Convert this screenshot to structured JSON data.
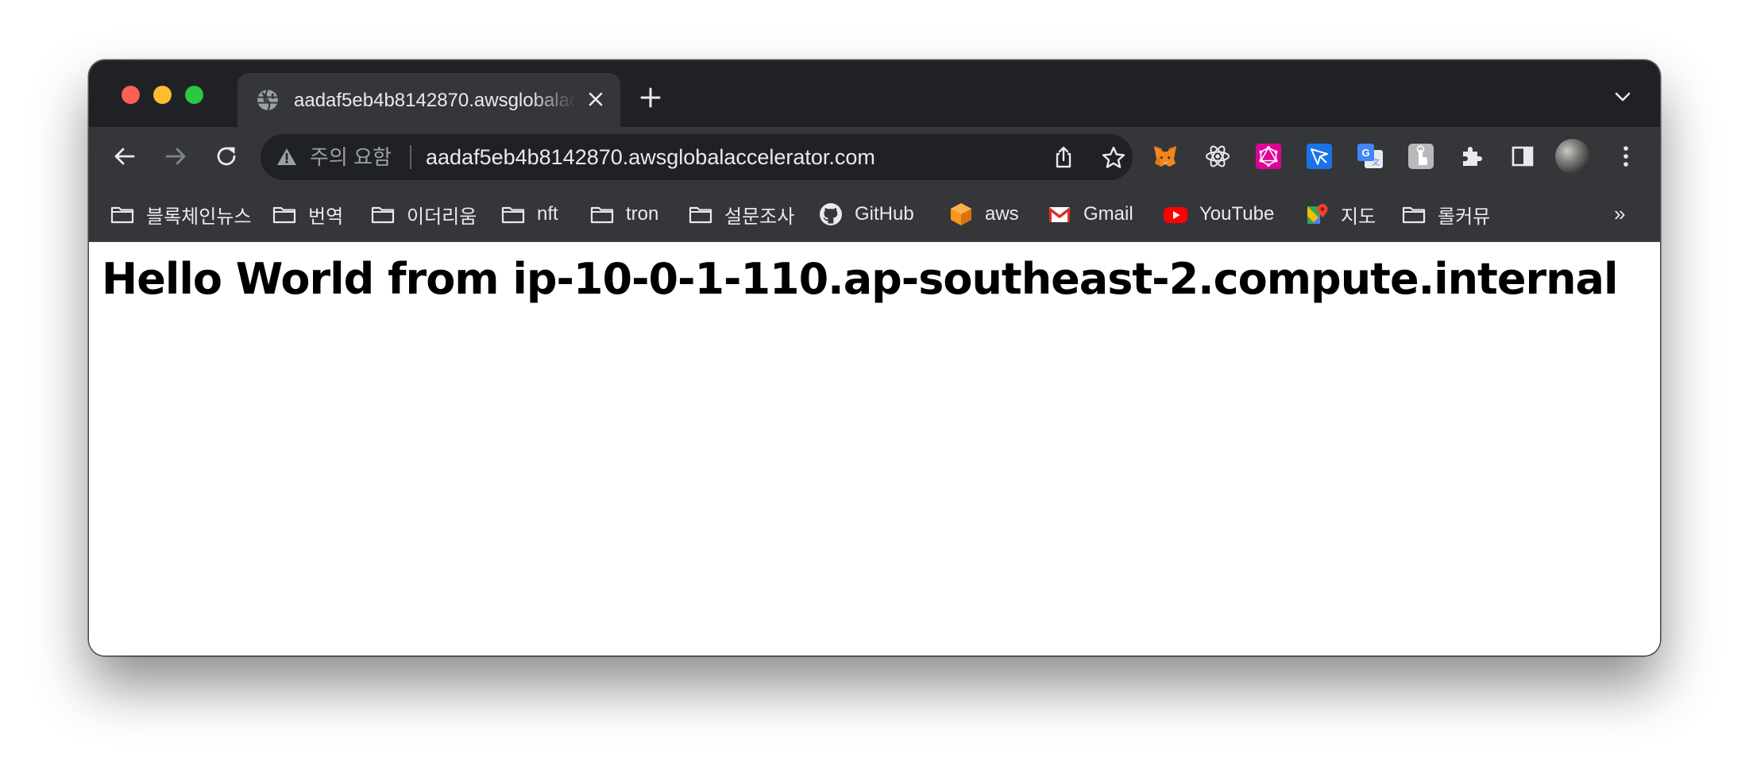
{
  "tab": {
    "title": "aadaf5eb4b8142870.awsglobalaccelerator.com"
  },
  "omnibox": {
    "security_label": "주의 요함",
    "url": "aadaf5eb4b8142870.awsglobalaccelerator.com"
  },
  "bookmarks": [
    {
      "label": "블록체인뉴스",
      "icon": "folder-icon"
    },
    {
      "label": "번역",
      "icon": "folder-icon"
    },
    {
      "label": "이더리움",
      "icon": "folder-icon"
    },
    {
      "label": "nft",
      "icon": "folder-icon"
    },
    {
      "label": "tron",
      "icon": "folder-icon"
    },
    {
      "label": "설문조사",
      "icon": "folder-icon"
    },
    {
      "label": "GitHub",
      "icon": "github-icon"
    },
    {
      "label": "aws",
      "icon": "aws-cube-icon"
    },
    {
      "label": "Gmail",
      "icon": "gmail-icon"
    },
    {
      "label": "YouTube",
      "icon": "youtube-icon"
    },
    {
      "label": "지도",
      "icon": "google-maps-icon"
    },
    {
      "label": "롤커뮤",
      "icon": "folder-icon"
    }
  ],
  "bookmarks_overflow": "»",
  "page": {
    "heading": "Hello World from ip-10-0-1-110.ap-southeast-2.compute.internal"
  },
  "colors": {
    "tab_strip": "#202124",
    "toolbar": "#35363a",
    "omnibox": "#202124",
    "text_light": "#e8eaed",
    "text_muted": "#9aa0a6",
    "traffic_red": "#fe5f57",
    "traffic_yellow": "#febc2e",
    "traffic_green": "#28c840"
  }
}
